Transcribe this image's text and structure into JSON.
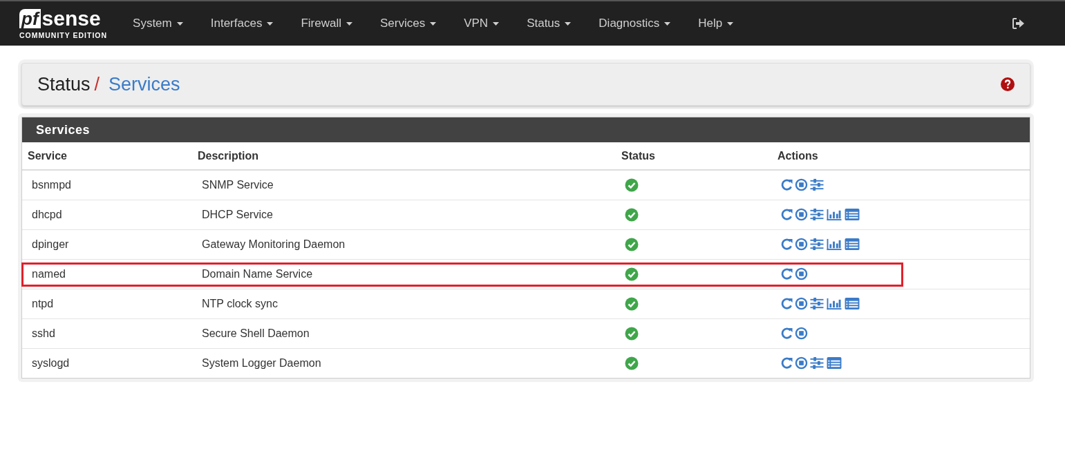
{
  "navbar": {
    "logo": {
      "mark": "pf",
      "word": "sense",
      "tagline": "COMMUNITY EDITION"
    },
    "menus": [
      {
        "label": "System"
      },
      {
        "label": "Interfaces"
      },
      {
        "label": "Firewall"
      },
      {
        "label": "Services"
      },
      {
        "label": "VPN"
      },
      {
        "label": "Status"
      },
      {
        "label": "Diagnostics"
      },
      {
        "label": "Help"
      }
    ]
  },
  "breadcrumb": {
    "parent": "Status",
    "separator": "/",
    "current": "Services"
  },
  "panel": {
    "title": "Services",
    "columns": [
      "Service",
      "Description",
      "Status",
      "Actions"
    ],
    "rows": [
      {
        "service": "bsnmpd",
        "description": "SNMP Service",
        "status": {
          "kind": "running"
        },
        "highlighted": false,
        "actions": [
          {
            "kind": "restart"
          },
          {
            "kind": "stop"
          },
          {
            "kind": "settings"
          }
        ]
      },
      {
        "service": "dhcpd",
        "description": "DHCP Service",
        "status": {
          "kind": "running"
        },
        "highlighted": false,
        "actions": [
          {
            "kind": "restart"
          },
          {
            "kind": "stop"
          },
          {
            "kind": "settings"
          },
          {
            "kind": "graph"
          },
          {
            "kind": "log"
          }
        ]
      },
      {
        "service": "dpinger",
        "description": "Gateway Monitoring Daemon",
        "status": {
          "kind": "running"
        },
        "highlighted": false,
        "actions": [
          {
            "kind": "restart"
          },
          {
            "kind": "stop"
          },
          {
            "kind": "settings"
          },
          {
            "kind": "graph"
          },
          {
            "kind": "log"
          }
        ]
      },
      {
        "service": "named",
        "description": "Domain Name Service",
        "status": {
          "kind": "running"
        },
        "highlighted": true,
        "actions": [
          {
            "kind": "restart"
          },
          {
            "kind": "stop"
          }
        ]
      },
      {
        "service": "ntpd",
        "description": "NTP clock sync",
        "status": {
          "kind": "running"
        },
        "highlighted": false,
        "actions": [
          {
            "kind": "restart"
          },
          {
            "kind": "stop"
          },
          {
            "kind": "settings"
          },
          {
            "kind": "graph"
          },
          {
            "kind": "log"
          }
        ]
      },
      {
        "service": "sshd",
        "description": "Secure Shell Daemon",
        "status": {
          "kind": "running"
        },
        "highlighted": false,
        "actions": [
          {
            "kind": "restart"
          },
          {
            "kind": "stop"
          }
        ]
      },
      {
        "service": "syslogd",
        "description": "System Logger Daemon",
        "status": {
          "kind": "running"
        },
        "highlighted": false,
        "actions": [
          {
            "kind": "restart"
          },
          {
            "kind": "stop"
          },
          {
            "kind": "settings"
          },
          {
            "kind": "log"
          }
        ]
      }
    ]
  }
}
